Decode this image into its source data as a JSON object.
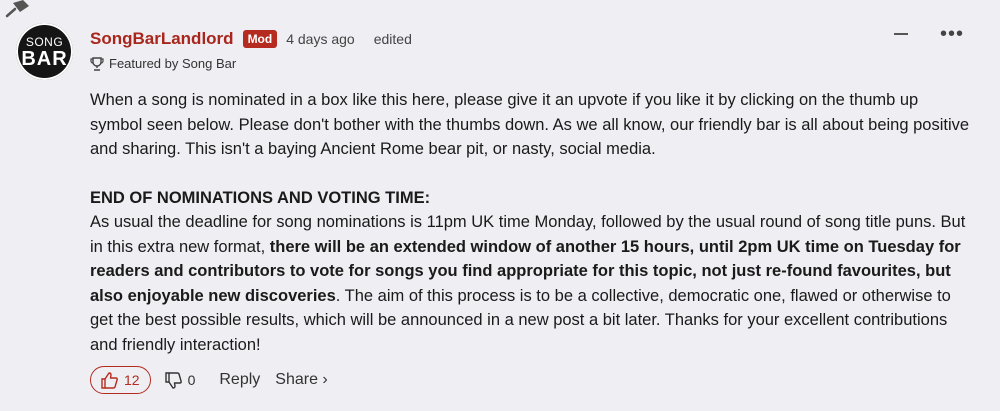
{
  "comment": {
    "avatar_line1": "SONG",
    "avatar_line2": "BAR",
    "username": "SongBarLandlord",
    "badge": "Mod",
    "timestamp": "4 days ago",
    "edited_label": "edited",
    "featured_label": "Featured by Song Bar",
    "paragraph1": "When a song is nominated in a box like this here, please give it an upvote if you like it by clicking on the thumb up symbol seen below. Please don't bother with the thumbs down. As we all know, our friendly bar is all about being positive and sharing. This isn't a baying Ancient Rome bear pit, or nasty, social media.",
    "heading": "END OF NOMINATIONS AND VOTING TIME:",
    "paragraph2_start": "As usual the deadline for song nominations is 11pm UK time Monday, followed by the usual round of song title puns. But in this extra new format, ",
    "paragraph2_bold": "there will be an extended window of another 15 hours, until 2pm UK time on Tuesday for readers and contributors to vote for songs you find appropriate for this topic, not just re-found favourites, but also enjoyable new discoveries",
    "paragraph2_end": ". The aim of this process is to be a collective, democratic one, flawed or otherwise to get the best possible results, which will be announced in a new post a bit later. Thanks for your excellent contributions and friendly interaction!",
    "upvotes": "12",
    "downvotes": "0",
    "reply_label": "Reply",
    "share_label": "Share ›",
    "collapse_symbol": "",
    "more_symbol": "•••"
  },
  "colors": {
    "accent": "#b52b1f",
    "username": "#a8261c",
    "background": "#eeeef3"
  }
}
